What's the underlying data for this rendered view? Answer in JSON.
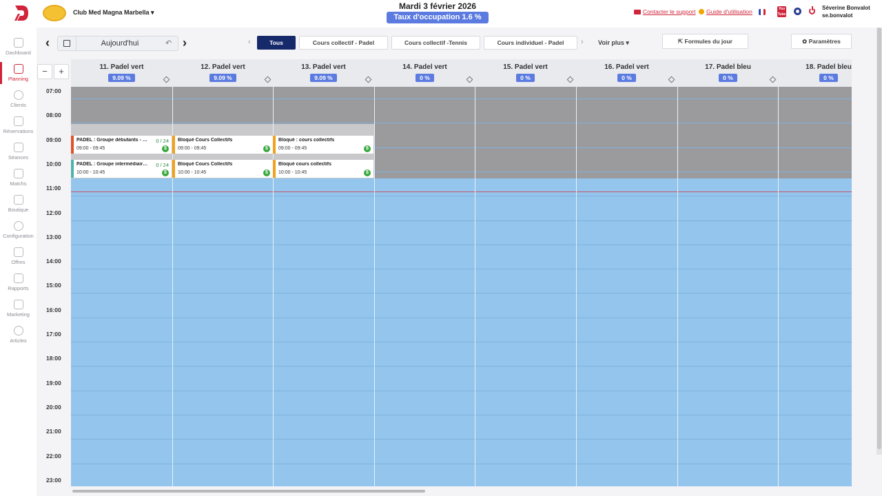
{
  "header": {
    "club_name": "Club Med Magna Marbella ▾",
    "date": "Mardi 3 février 2026",
    "occupancy": "Taux d'occupation 1.6 %",
    "support_link": "Contacter le support",
    "guide_link": "Guide d'utilisation",
    "user_name": "Séverine Bonvalot",
    "user_login": "se.bonvalot",
    "youtube_label": "You Tube"
  },
  "sidebar": {
    "items": [
      {
        "label": "Dashboard",
        "icon": "dashboard-icon"
      },
      {
        "label": "Planning",
        "icon": "calendar-icon",
        "active": true
      },
      {
        "label": "Clients",
        "icon": "user-icon"
      },
      {
        "label": "Réservations",
        "icon": "edit-icon"
      },
      {
        "label": "Séances",
        "icon": "graduation-cap-icon"
      },
      {
        "label": "Matchs",
        "icon": "star-icon"
      },
      {
        "label": "Boutique",
        "icon": "cart-icon"
      },
      {
        "label": "Configuration",
        "icon": "gears-icon"
      },
      {
        "label": "Offres",
        "icon": "tag-icon"
      },
      {
        "label": "Rapports",
        "icon": "activity-icon"
      },
      {
        "label": "Marketing",
        "icon": "megaphone-icon"
      },
      {
        "label": "Articles",
        "icon": "circle-icon"
      }
    ]
  },
  "toolbar": {
    "today": "Aujourd'hui",
    "filters": [
      {
        "label": "Tous",
        "active": true
      },
      {
        "label": "Cours collectif - Padel",
        "active": false
      },
      {
        "label": "Cours collectif -Tennis",
        "active": false
      },
      {
        "label": "Cours individuel - Padel",
        "active": false
      }
    ],
    "voir_plus": "Voir plus ▾",
    "formules": "Formules du jour",
    "parametres": "✿ Paramètres",
    "zoom_out": "−",
    "zoom_in": "+"
  },
  "courts": [
    {
      "name": "11. Padel vert",
      "pct": "9.09 %"
    },
    {
      "name": "12. Padel vert",
      "pct": "9.09 %"
    },
    {
      "name": "13. Padel vert",
      "pct": "9.09 %"
    },
    {
      "name": "14. Padel vert",
      "pct": "0 %"
    },
    {
      "name": "15. Padel vert",
      "pct": "0 %"
    },
    {
      "name": "16. Padel vert",
      "pct": "0 %"
    },
    {
      "name": "17. Padel bleu",
      "pct": "0 %"
    },
    {
      "name": "18. Padel bleu",
      "pct": "0 %"
    }
  ],
  "times": [
    "07:00",
    "08:00",
    "09:00",
    "10:00",
    "11:00",
    "12:00",
    "13:00",
    "14:00",
    "15:00",
    "16:00",
    "17:00",
    "18:00",
    "19:00",
    "20:00",
    "21:00",
    "22:00",
    "23:00"
  ],
  "bookings": [
    {
      "court": 0,
      "title": "PADEL : Groupe débutants - C...",
      "time": "09:00 - 09:45",
      "count": "0 / 24",
      "color": "#e0522d"
    },
    {
      "court": 0,
      "title": "PADEL : Groupe intermédiaire ...",
      "time": "10:00 - 10:45",
      "count": "0 / 24",
      "color": "#4fb3a9"
    },
    {
      "court": 1,
      "title": "Bloqué Cours Collectifs",
      "time": "09:00 - 09:45",
      "count": "",
      "color": "#f0a21e"
    },
    {
      "court": 1,
      "title": "Bloqué Cours Collectifs",
      "time": "10:00 - 10:45",
      "count": "",
      "color": "#f0a21e"
    },
    {
      "court": 2,
      "title": "Bloqué : cours collectifs",
      "time": "09:00 - 09:45",
      "count": "",
      "color": "#f0a21e"
    },
    {
      "court": 2,
      "title": "Bloqué cours collectifs",
      "time": "10:00 - 10:45",
      "count": "",
      "color": "#f0a21e"
    }
  ],
  "payment_symbol": "$",
  "colors": {
    "brand_red": "#d0243a",
    "accent_blue": "#5b7be0",
    "active_filter": "#162a6b",
    "available_slot": "#94c5ec",
    "closed_slot": "#9b9b9e"
  }
}
